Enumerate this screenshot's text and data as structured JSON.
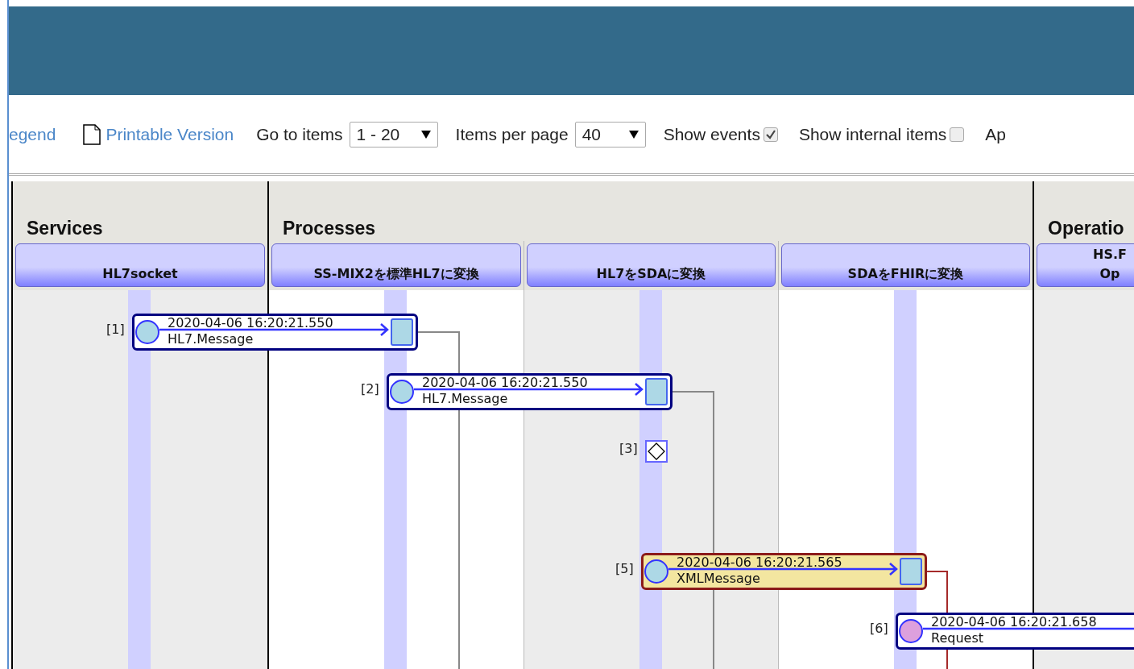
{
  "toolbar": {
    "legend_link": "egend",
    "printable_link": "Printable Version",
    "go_to": {
      "label": "Go to items",
      "value": "1 - 20"
    },
    "per_page": {
      "label": "Items per page",
      "value": "40"
    },
    "show_events": {
      "label": "Show events",
      "checked": true
    },
    "show_internal": {
      "label": "Show internal items",
      "checked": false
    },
    "cut_item": "Ap"
  },
  "groups": [
    {
      "title": "Services",
      "hosts": [
        {
          "name": "HL7socket"
        }
      ]
    },
    {
      "title": "Processes",
      "hosts": [
        {
          "name": "SS-MIX2を標準HL7に変換"
        },
        {
          "name": "HL7をSDAに変換"
        },
        {
          "name": "SDAをFHIRに変換"
        }
      ]
    },
    {
      "title": "Operatio",
      "hosts": [
        {
          "name": "HS.F\nOp"
        }
      ]
    }
  ],
  "items": [
    {
      "kind": "message",
      "label": "[1]",
      "time": "2020-04-06 16:20:21.550",
      "type": "HL7.Message",
      "color": "#add8e6",
      "selected": false
    },
    {
      "kind": "message",
      "label": "[2]",
      "time": "2020-04-06 16:20:21.550",
      "type": "HL7.Message",
      "color": "#add8e6",
      "selected": false
    },
    {
      "kind": "event",
      "label": "[3]"
    },
    {
      "kind": "message",
      "label": "[5]",
      "time": "2020-04-06 16:20:21.565",
      "type": "XMLMessage",
      "color": "#add8e6",
      "selected": true
    },
    {
      "kind": "message",
      "label": "[6]",
      "time": "2020-04-06 16:20:21.658",
      "type": "Request",
      "color": "#dda0dd",
      "selected": false
    }
  ]
}
